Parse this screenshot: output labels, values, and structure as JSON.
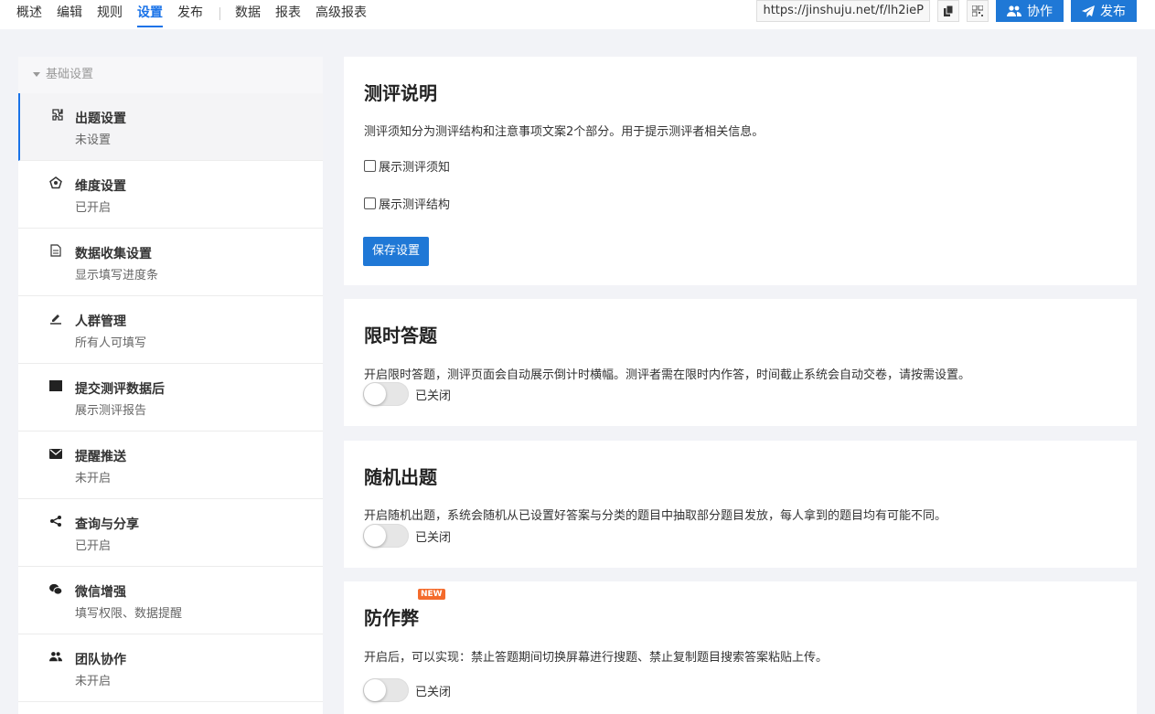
{
  "nav": {
    "items": [
      {
        "label": "概述"
      },
      {
        "label": "编辑"
      },
      {
        "label": "规则"
      },
      {
        "label": "设置"
      },
      {
        "label": "发布"
      }
    ],
    "items2": [
      {
        "label": "数据"
      },
      {
        "label": "报表"
      },
      {
        "label": "高级报表"
      }
    ],
    "active": "设置",
    "url": "https://jinshuju.net/f/lh2ieP",
    "collab_label": "协作",
    "publish_label": "发布"
  },
  "sidebar": {
    "group_label": "基础设置",
    "items": [
      {
        "title": "出题设置",
        "sub": "未设置",
        "icon": "puzzle-icon"
      },
      {
        "title": "维度设置",
        "sub": "已开启",
        "icon": "pentagon-icon"
      },
      {
        "title": "数据收集设置",
        "sub": "显示填写进度条",
        "icon": "document-icon"
      },
      {
        "title": "人群管理",
        "sub": "所有人可填写",
        "icon": "pen-icon"
      },
      {
        "title": "提交测评数据后",
        "sub": "展示测评报告",
        "icon": "square-icon"
      },
      {
        "title": "提醒推送",
        "sub": "未开启",
        "icon": "envelope-icon"
      },
      {
        "title": "查询与分享",
        "sub": "已开启",
        "icon": "share-icon"
      },
      {
        "title": "微信增强",
        "sub": "填写权限、数据提醒",
        "icon": "wechat-icon"
      },
      {
        "title": "团队协作",
        "sub": "未开启",
        "icon": "team-icon"
      }
    ]
  },
  "cards": {
    "intro": {
      "title": "测评说明",
      "desc": "测评须知分为测评结构和注意事项文案2个部分。用于提示测评者相关信息。",
      "check1": "展示测评须知",
      "check2": "展示测评结构",
      "save": "保存设置"
    },
    "timed": {
      "title": "限时答题",
      "desc": "开启限时答题，测评页面会自动展示倒计时横幅。测评者需在限时内作答，时间截止系统会自动交卷，请按需设置。",
      "toggle_label": "已关闭"
    },
    "random": {
      "title": "随机出题",
      "desc": "开启随机出题，系统会随机从已设置好答案与分类的题目中抽取部分题目发放，每人拿到的题目均有可能不同。",
      "toggle_label": "已关闭"
    },
    "anticheat": {
      "badge": "NEW",
      "title": "防作弊",
      "desc": "开启后，可以实现：禁止答题期间切换屏幕进行搜题、禁止复制题目搜索答案粘贴上传。",
      "toggle_label": "已关闭"
    }
  },
  "colors": {
    "accent": "#1a73e8",
    "primary_button": "#1f78d6",
    "badge": "#f46b2c"
  }
}
